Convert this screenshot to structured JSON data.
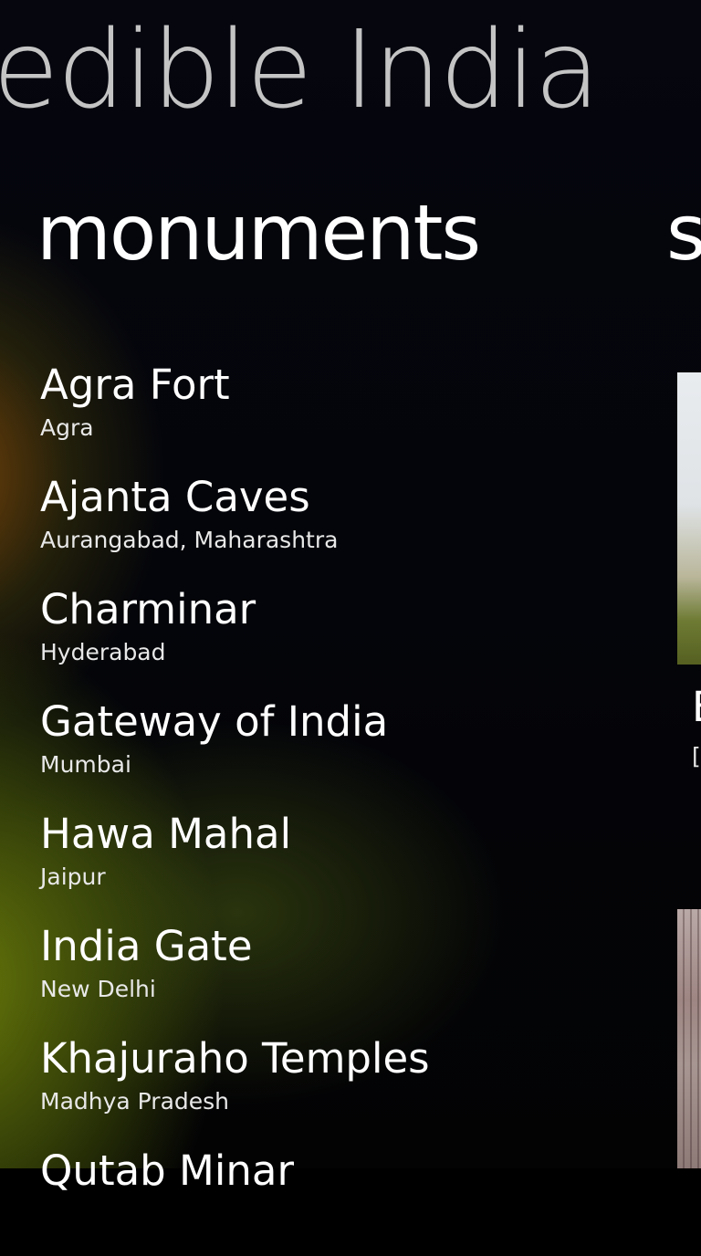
{
  "app": {
    "title": "edible India"
  },
  "pivot": {
    "current_header": "monuments",
    "next_header_peek": "s"
  },
  "monuments": [
    {
      "name": "Agra Fort",
      "location": "Agra"
    },
    {
      "name": "Ajanta Caves",
      "location": "Aurangabad, Maharashtra"
    },
    {
      "name": "Charminar",
      "location": "Hyderabad"
    },
    {
      "name": "Gateway of India",
      "location": "Mumbai"
    },
    {
      "name": "Hawa Mahal",
      "location": "Jaipur"
    },
    {
      "name": "India Gate",
      "location": "New Delhi"
    },
    {
      "name": "Khajuraho Temples",
      "location": "Madhya Pradesh"
    },
    {
      "name": "Qutab Minar",
      "location": ""
    }
  ],
  "next_panel_peek": {
    "card_title_peek": "E",
    "card_sub_peek": "["
  }
}
